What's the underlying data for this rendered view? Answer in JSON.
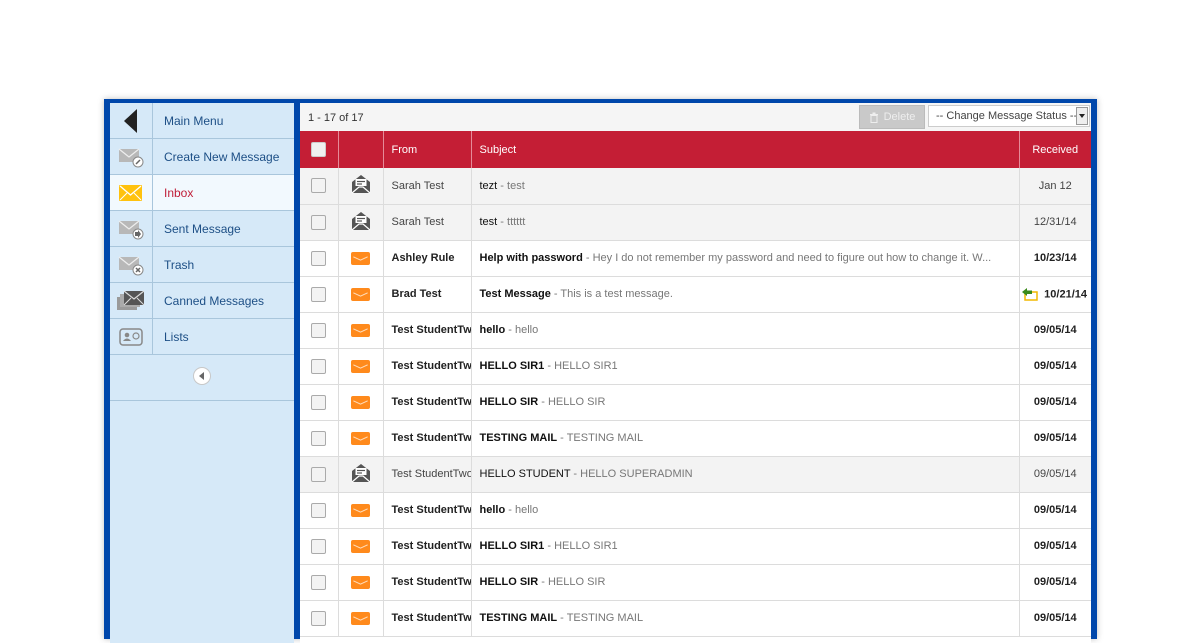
{
  "sidebar": {
    "items": [
      {
        "label": "Main Menu",
        "icon": "back-arrow-icon",
        "active": false
      },
      {
        "label": "Create New Message",
        "icon": "compose-mail-icon",
        "active": false
      },
      {
        "label": "Inbox",
        "icon": "inbox-mail-icon",
        "active": true
      },
      {
        "label": "Sent Message",
        "icon": "sent-mail-icon",
        "active": false
      },
      {
        "label": "Trash",
        "icon": "trash-mail-icon",
        "active": false
      },
      {
        "label": "Canned Messages",
        "icon": "canned-messages-icon",
        "active": false
      },
      {
        "label": "Lists",
        "icon": "contact-card-icon",
        "active": false
      }
    ],
    "collapse_icon": "collapse-left-icon"
  },
  "toolbar": {
    "count": "1 - 17 of 17",
    "delete_label": "Delete",
    "status_select": "-- Change Message Status --"
  },
  "table": {
    "headers": {
      "from": "From",
      "subject": "Subject",
      "received": "Received"
    },
    "rows": [
      {
        "read": true,
        "from": "Sarah Test",
        "subject": "tezt",
        "preview": "test",
        "received": "Jan 12",
        "replied": false
      },
      {
        "read": true,
        "from": "Sarah Test",
        "subject": "test",
        "preview": "tttttt",
        "received": "12/31/14",
        "replied": false
      },
      {
        "read": false,
        "from": "Ashley Rule",
        "subject": "Help with password",
        "preview": "Hey I do not remember my password and need to figure out how to change it. W...",
        "received": "10/23/14",
        "replied": false
      },
      {
        "read": false,
        "from": "Brad Test",
        "subject": "Test Message",
        "preview": "This is a test message.",
        "received": "10/21/14",
        "replied": true
      },
      {
        "read": false,
        "from": "Test StudentTwo",
        "subject": "hello",
        "preview": "hello",
        "received": "09/05/14",
        "replied": false
      },
      {
        "read": false,
        "from": "Test StudentTwo",
        "subject": "HELLO SIR1",
        "preview": "HELLO SIR1",
        "received": "09/05/14",
        "replied": false
      },
      {
        "read": false,
        "from": "Test StudentTwo",
        "subject": "HELLO SIR",
        "preview": "HELLO SIR",
        "received": "09/05/14",
        "replied": false
      },
      {
        "read": false,
        "from": "Test StudentTwo",
        "subject": "TESTING MAIL",
        "preview": "TESTING MAIL",
        "received": "09/05/14",
        "replied": false
      },
      {
        "read": true,
        "from": "Test StudentTwo",
        "subject": "HELLO STUDENT",
        "preview": "HELLO SUPERADMIN",
        "received": "09/05/14",
        "replied": false
      },
      {
        "read": false,
        "from": "Test StudentTwo",
        "subject": "hello",
        "preview": "hello",
        "received": "09/05/14",
        "replied": false
      },
      {
        "read": false,
        "from": "Test StudentTwo",
        "subject": "HELLO SIR1",
        "preview": "HELLO SIR1",
        "received": "09/05/14",
        "replied": false
      },
      {
        "read": false,
        "from": "Test StudentTwo",
        "subject": "HELLO SIR",
        "preview": "HELLO SIR",
        "received": "09/05/14",
        "replied": false
      },
      {
        "read": false,
        "from": "Test StudentTwo",
        "subject": "TESTING MAIL",
        "preview": "TESTING MAIL",
        "received": "09/05/14",
        "replied": false
      }
    ]
  },
  "colors": {
    "frame": "#0047ab",
    "header_red": "#c41e35",
    "sidebar_bg": "#d6e9f8",
    "unread_envelope": "#ff8a1c",
    "inbox_yellow": "#ffc20e"
  }
}
